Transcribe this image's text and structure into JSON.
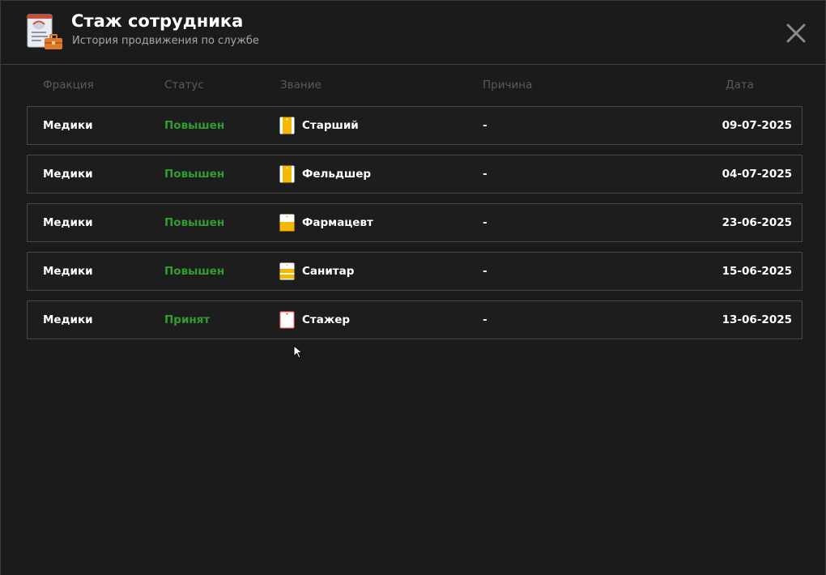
{
  "window": {
    "title": "Стаж сотрудника",
    "subtitle": "История продвижения по службе",
    "icon": "document-briefcase-icon",
    "close_icon": "close-icon"
  },
  "columns": {
    "faction": "Фракция",
    "status": "Статус",
    "rank": "Звание",
    "reason": "Причина",
    "date": "Дата"
  },
  "colors": {
    "background": "#1b1b1b",
    "status_green": "#2f9e2f",
    "rank_yellow": "#f5b800"
  },
  "rows": [
    {
      "faction": "Медики",
      "status": "Повышен",
      "rank": "Старший",
      "rank_icon": "rank-stripe-icon",
      "reason": "-",
      "date": "09-07-2025"
    },
    {
      "faction": "Медики",
      "status": "Повышен",
      "rank": "Фельдшер",
      "rank_icon": "rank-stripe-icon",
      "reason": "-",
      "date": "04-07-2025"
    },
    {
      "faction": "Медики",
      "status": "Повышен",
      "rank": "Фармацевт",
      "rank_icon": "rank-band-icon",
      "reason": "-",
      "date": "23-06-2025"
    },
    {
      "faction": "Медики",
      "status": "Повышен",
      "rank": "Санитар",
      "rank_icon": "rank-stripes-icon",
      "reason": "-",
      "date": "15-06-2025"
    },
    {
      "faction": "Медики",
      "status": "Принят",
      "rank": "Стажер",
      "rank_icon": "rank-empty-icon",
      "reason": "-",
      "date": "13-06-2025"
    }
  ]
}
